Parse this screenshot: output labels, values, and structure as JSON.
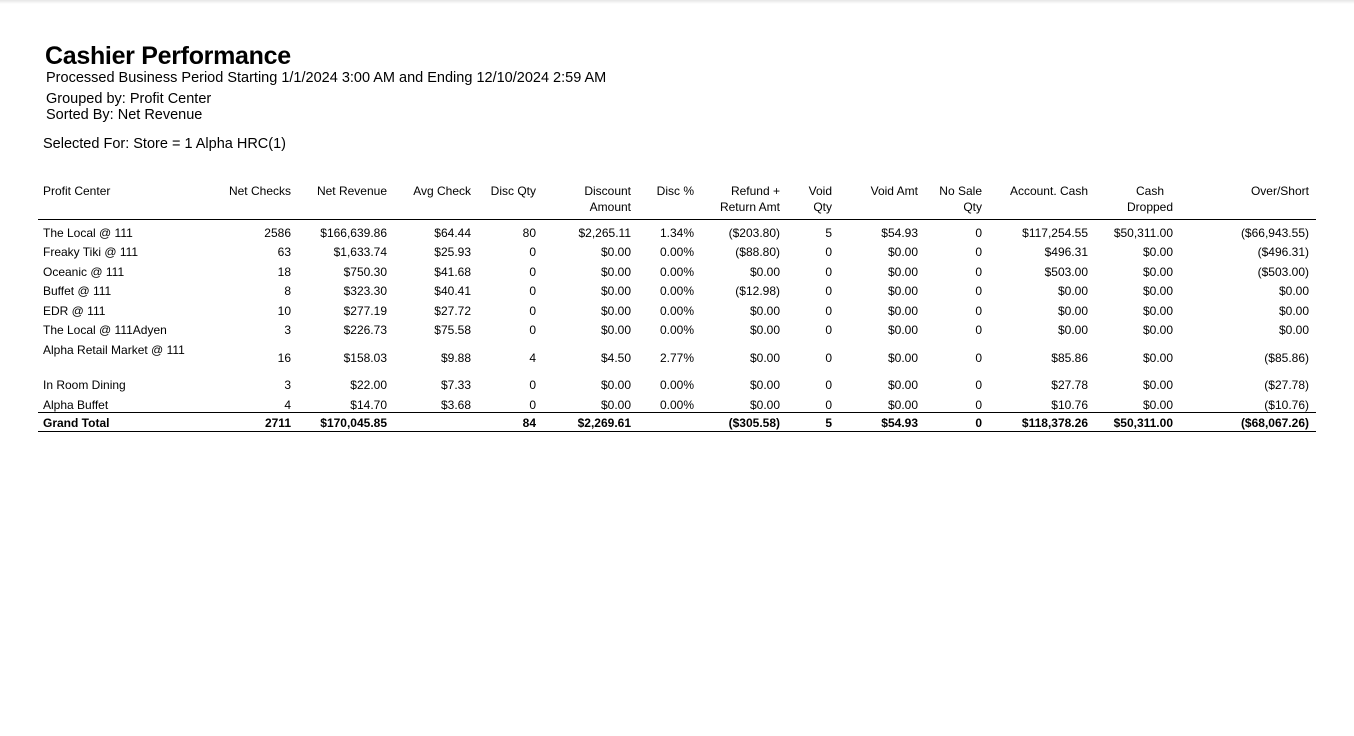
{
  "report": {
    "title": "Cashier Performance",
    "period": "Processed Business Period Starting 1/1/2024 3:00 AM and Ending 12/10/2024 2:59 AM",
    "grouped_by": "Grouped by: Profit Center",
    "sorted_by": "Sorted By: Net Revenue",
    "selected_for": "Selected For:  Store = 1 Alpha HRC(1)"
  },
  "table": {
    "headers": {
      "profit_center": "Profit Center",
      "net_checks": "Net Checks",
      "net_revenue": "Net Revenue",
      "avg_check": "Avg Check",
      "disc_qty": "Disc Qty",
      "discount_amount_1": "Discount",
      "discount_amount_2": "Amount",
      "disc_pct": "Disc %",
      "refund_1": "Refund +",
      "refund_2": "Return Amt",
      "void_qty_1": "Void",
      "void_qty_2": "Qty",
      "void_amt": "Void Amt",
      "no_sale_1": "No Sale",
      "no_sale_2": "Qty",
      "account_cash": "Account. Cash",
      "cash_dropped_1": "Cash",
      "cash_dropped_2": "Dropped",
      "over_short": "Over/Short"
    },
    "rows": [
      {
        "profit_center": "The Local @ 111",
        "net_checks": "2586",
        "net_revenue": "$166,639.86",
        "avg_check": "$64.44",
        "disc_qty": "80",
        "discount_amount": "$2,265.11",
        "disc_pct": "1.34%",
        "refund": "($203.80)",
        "void_qty": "5",
        "void_amt": "$54.93",
        "no_sale": "0",
        "account_cash": "$117,254.55",
        "cash_dropped": "$50,311.00",
        "over_short": "($66,943.55)"
      },
      {
        "profit_center": "Freaky Tiki @ 111",
        "net_checks": "63",
        "net_revenue": "$1,633.74",
        "avg_check": "$25.93",
        "disc_qty": "0",
        "discount_amount": "$0.00",
        "disc_pct": "0.00%",
        "refund": "($88.80)",
        "void_qty": "0",
        "void_amt": "$0.00",
        "no_sale": "0",
        "account_cash": "$496.31",
        "cash_dropped": "$0.00",
        "over_short": "($496.31)"
      },
      {
        "profit_center": "Oceanic @ 111",
        "net_checks": "18",
        "net_revenue": "$750.30",
        "avg_check": "$41.68",
        "disc_qty": "0",
        "discount_amount": "$0.00",
        "disc_pct": "0.00%",
        "refund": "$0.00",
        "void_qty": "0",
        "void_amt": "$0.00",
        "no_sale": "0",
        "account_cash": "$503.00",
        "cash_dropped": "$0.00",
        "over_short": "($503.00)"
      },
      {
        "profit_center": "Buffet @ 111",
        "net_checks": "8",
        "net_revenue": "$323.30",
        "avg_check": "$40.41",
        "disc_qty": "0",
        "discount_amount": "$0.00",
        "disc_pct": "0.00%",
        "refund": "($12.98)",
        "void_qty": "0",
        "void_amt": "$0.00",
        "no_sale": "0",
        "account_cash": "$0.00",
        "cash_dropped": "$0.00",
        "over_short": "$0.00"
      },
      {
        "profit_center": "EDR @ 111",
        "net_checks": "10",
        "net_revenue": "$277.19",
        "avg_check": "$27.72",
        "disc_qty": "0",
        "discount_amount": "$0.00",
        "disc_pct": "0.00%",
        "refund": "$0.00",
        "void_qty": "0",
        "void_amt": "$0.00",
        "no_sale": "0",
        "account_cash": "$0.00",
        "cash_dropped": "$0.00",
        "over_short": "$0.00"
      },
      {
        "profit_center": "The Local @ 111Adyen",
        "net_checks": "3",
        "net_revenue": "$226.73",
        "avg_check": "$75.58",
        "disc_qty": "0",
        "discount_amount": "$0.00",
        "disc_pct": "0.00%",
        "refund": "$0.00",
        "void_qty": "0",
        "void_amt": "$0.00",
        "no_sale": "0",
        "account_cash": "$0.00",
        "cash_dropped": "$0.00",
        "over_short": "$0.00"
      },
      {
        "profit_center": "Alpha Retail Market @ 111",
        "net_checks": "16",
        "net_revenue": "$158.03",
        "avg_check": "$9.88",
        "disc_qty": "4",
        "discount_amount": "$4.50",
        "disc_pct": "2.77%",
        "refund": "$0.00",
        "void_qty": "0",
        "void_amt": "$0.00",
        "no_sale": "0",
        "account_cash": "$85.86",
        "cash_dropped": "$0.00",
        "over_short": "($85.86)"
      },
      {
        "profit_center": "In Room Dining",
        "net_checks": "3",
        "net_revenue": "$22.00",
        "avg_check": "$7.33",
        "disc_qty": "0",
        "discount_amount": "$0.00",
        "disc_pct": "0.00%",
        "refund": "$0.00",
        "void_qty": "0",
        "void_amt": "$0.00",
        "no_sale": "0",
        "account_cash": "$27.78",
        "cash_dropped": "$0.00",
        "over_short": "($27.78)"
      },
      {
        "profit_center": "Alpha Buffet",
        "net_checks": "4",
        "net_revenue": "$14.70",
        "avg_check": "$3.68",
        "disc_qty": "0",
        "discount_amount": "$0.00",
        "disc_pct": "0.00%",
        "refund": "$0.00",
        "void_qty": "0",
        "void_amt": "$0.00",
        "no_sale": "0",
        "account_cash": "$10.76",
        "cash_dropped": "$0.00",
        "over_short": "($10.76)"
      }
    ],
    "grand_total": {
      "label": "Grand Total",
      "net_checks": "2711",
      "net_revenue": "$170,045.85",
      "avg_check": "",
      "disc_qty": "84",
      "discount_amount": "$2,269.61",
      "disc_pct": "",
      "refund": "($305.58)",
      "void_qty": "5",
      "void_amt": "$54.93",
      "no_sale": "0",
      "account_cash": "$118,378.26",
      "cash_dropped": "$50,311.00",
      "over_short": "($68,067.26)"
    }
  }
}
